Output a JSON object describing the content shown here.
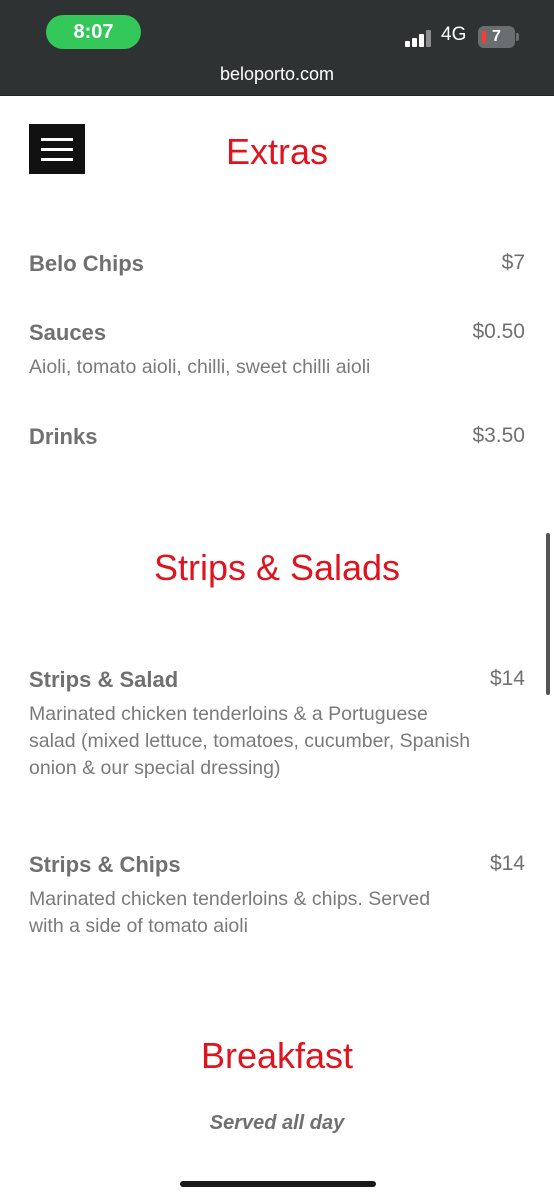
{
  "status": {
    "time": "8:07",
    "network": "4G",
    "battery": "7"
  },
  "browser": {
    "url": "beloporto.com"
  },
  "sections": {
    "extras": {
      "title": "Extras",
      "items": [
        {
          "name": "Belo Chips",
          "price": "$7",
          "desc": ""
        },
        {
          "name": "Sauces",
          "price": "$0.50",
          "desc": "Aioli, tomato aioli, chilli, sweet chilli aioli"
        },
        {
          "name": "Drinks",
          "price": "$3.50",
          "desc": ""
        }
      ]
    },
    "strips": {
      "title": "Strips & Salads",
      "items": [
        {
          "name": "Strips & Salad",
          "price": "$14",
          "desc": "Marinated chicken tenderloins & a Portuguese salad (mixed lettuce, tomatoes, cucumber, Spanish onion & our special dressing)"
        },
        {
          "name": "Strips & Chips",
          "price": "$14",
          "desc": "Marinated chicken tenderloins & chips. Served with a side of tomato aioli"
        }
      ]
    },
    "breakfast": {
      "title": "Breakfast",
      "subtitle": "Served all day"
    }
  },
  "colors": {
    "accent": "#e0141f",
    "text": "#707070",
    "status_pill": "#34c759"
  }
}
